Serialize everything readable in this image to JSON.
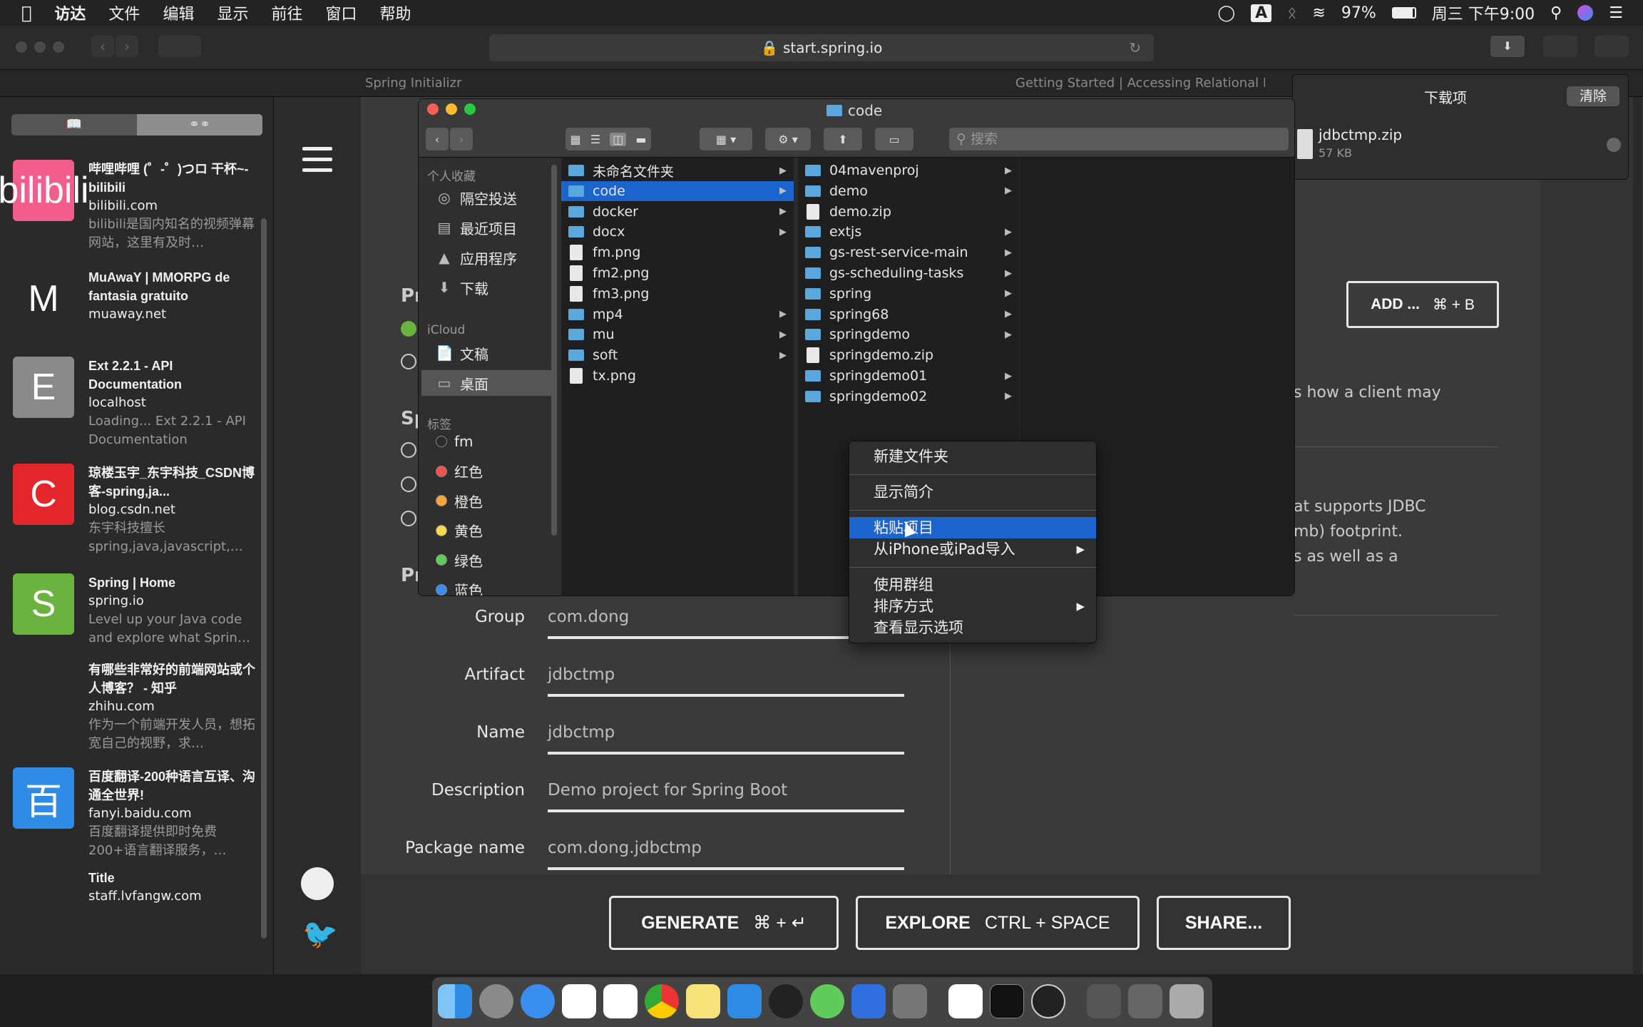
{
  "menubar": {
    "apple_icon": "apple-icon",
    "items": [
      "访达",
      "文件",
      "编辑",
      "显示",
      "前往",
      "窗口",
      "帮助"
    ],
    "battery": "97%",
    "clock": "周三 下午9:00"
  },
  "browser": {
    "url": "start.spring.io",
    "tabs": [
      "Spring Initializr",
      "Getting Started | Accessing Relational Da"
    ]
  },
  "reading_list": [
    {
      "title": "哔哩哔哩 (゜-゜)つロ 干杯~-bilibili",
      "host": "bilibili.com",
      "desc": "bilibili是国内知名的视频弹幕网站，这里有及时…",
      "thumb": "bilibili",
      "color": "#f25d8e"
    },
    {
      "title": "MuAwaY | MMORPG de fantasia gratuito",
      "host": "muaway.net",
      "desc": "",
      "thumb": "M",
      "color": "#2a2a2a"
    },
    {
      "title": "Ext 2.2.1 - API Documentation",
      "host": "localhost",
      "desc": "Loading... Ext 2.2.1 - API Documentation",
      "thumb": "E",
      "color": "#8a8a8a"
    },
    {
      "title": "琼楼玉宇_东宇科技_CSDN博客-spring,ja...",
      "host": "blog.csdn.net",
      "desc": "东宇科技擅长spring,java,javascript,…",
      "thumb": "C",
      "color": "#e3262b"
    },
    {
      "title": "Spring | Home",
      "host": "spring.io",
      "desc": "Level up your Java code and explore what Sprin…",
      "thumb": "S",
      "color": "#6bb33f"
    },
    {
      "title": "有哪些非常好的前端网站或个人博客？ - 知乎",
      "host": "zhihu.com",
      "desc": "作为一个前端开发人员，想拓宽自己的视野，求…",
      "thumb": "",
      "color": "#2a2a2a"
    },
    {
      "title": "百度翻译-200种语言互译、沟通全世界!",
      "host": "fanyi.baidu.com",
      "desc": "百度翻译提供即时免费200+语言翻译服务，…",
      "thumb": "百",
      "color": "#2f8ce6"
    },
    {
      "title": "Title",
      "host": "staff.lvfangw.com",
      "desc": "",
      "thumb": "",
      "color": "#2a2a2a"
    }
  ],
  "downloads": {
    "title": "下载项",
    "clear": "清除",
    "file": "jdbctmp.zip",
    "size": "57 KB"
  },
  "finder": {
    "title": "code",
    "search_placeholder": "搜索",
    "sidebar": {
      "favorites_label": "个人收藏",
      "favorites": [
        "隔空投送",
        "最近项目",
        "应用程序",
        "下载"
      ],
      "icloud_label": "iCloud",
      "icloud": [
        "文稿",
        "桌面"
      ],
      "tags_label": "标签",
      "tags": [
        {
          "name": "fm",
          "color": "#2b2b2b"
        },
        {
          "name": "红色",
          "color": "#f0524f"
        },
        {
          "name": "橙色",
          "color": "#f7a63a"
        },
        {
          "name": "黄色",
          "color": "#f7d94c"
        },
        {
          "name": "绿色",
          "color": "#5fcc5a"
        },
        {
          "name": "蓝色",
          "color": "#3a8ef0"
        }
      ]
    },
    "col1": [
      {
        "name": "未命名文件夹",
        "type": "folder"
      },
      {
        "name": "code",
        "type": "folder",
        "selected": true
      },
      {
        "name": "docker",
        "type": "folder"
      },
      {
        "name": "docx",
        "type": "folder"
      },
      {
        "name": "fm.png",
        "type": "file"
      },
      {
        "name": "fm2.png",
        "type": "file"
      },
      {
        "name": "fm3.png",
        "type": "file"
      },
      {
        "name": "mp4",
        "type": "folder"
      },
      {
        "name": "mu",
        "type": "folder"
      },
      {
        "name": "soft",
        "type": "folder"
      },
      {
        "name": "tx.png",
        "type": "file"
      }
    ],
    "col2": [
      {
        "name": "04mavenproj",
        "type": "folder"
      },
      {
        "name": "demo",
        "type": "folder"
      },
      {
        "name": "demo.zip",
        "type": "file"
      },
      {
        "name": "extjs",
        "type": "folder"
      },
      {
        "name": "gs-rest-service-main",
        "type": "folder"
      },
      {
        "name": "gs-scheduling-tasks",
        "type": "folder"
      },
      {
        "name": "spring",
        "type": "folder"
      },
      {
        "name": "spring68",
        "type": "folder"
      },
      {
        "name": "springdemo",
        "type": "folder"
      },
      {
        "name": "springdemo.zip",
        "type": "file"
      },
      {
        "name": "springdemo01",
        "type": "folder"
      },
      {
        "name": "springdemo02",
        "type": "folder"
      }
    ]
  },
  "context_menu": [
    "新建文件夹",
    "显示简介",
    "粘贴项目",
    "从iPhone或iPad导入",
    "使用群组",
    "排序方式",
    "查看显示选项"
  ],
  "initializr": {
    "fields": [
      {
        "label": "Group",
        "value": "com.dong"
      },
      {
        "label": "Artifact",
        "value": "jdbctmp"
      },
      {
        "label": "Name",
        "value": "jdbctmp"
      },
      {
        "label": "Description",
        "value": "Demo project for Spring Boot"
      },
      {
        "label": "Package name",
        "value": "com.dong.jdbctmp"
      }
    ],
    "add_label": "ADD ...",
    "add_shortcut": "⌘ + B",
    "desc_lines": [
      "s how a client may",
      "at supports JDBC",
      "mb) footprint.",
      "s as well as a"
    ],
    "generate": "GENERATE",
    "generate_shortcut": "⌘ + ↵",
    "explore": "EXPLORE",
    "explore_shortcut": "CTRL + SPACE",
    "share": "SHARE...",
    "side_letters": [
      "Pr",
      "Sp",
      "Pr"
    ]
  }
}
